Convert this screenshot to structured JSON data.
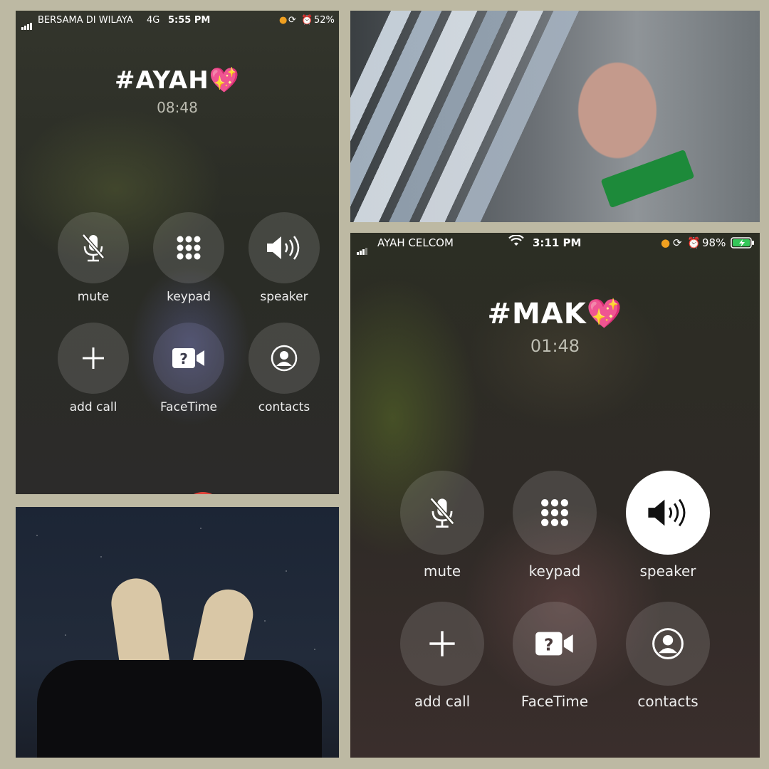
{
  "left_call": {
    "status": {
      "carrier": "BERSAMA DI WILAYA",
      "network": "4G",
      "time": "5:55 PM",
      "battery": "52%"
    },
    "contact": "#AYAH💖",
    "timer": "08:48",
    "buttons": [
      {
        "label": "mute",
        "icon": "mic-slash-icon"
      },
      {
        "label": "keypad",
        "icon": "keypad-icon"
      },
      {
        "label": "speaker",
        "icon": "speaker-icon"
      },
      {
        "label": "add call",
        "icon": "plus-icon"
      },
      {
        "label": "FaceTime",
        "icon": "facetime-icon"
      },
      {
        "label": "contacts",
        "icon": "contacts-icon"
      }
    ]
  },
  "right_call": {
    "status": {
      "carrier": "AYAH CELCOM",
      "time": "3:11 PM",
      "battery": "98%"
    },
    "contact": "#MAK💖",
    "timer": "01:48",
    "buttons": [
      {
        "label": "mute",
        "icon": "mic-slash-icon"
      },
      {
        "label": "keypad",
        "icon": "keypad-icon"
      },
      {
        "label": "speaker",
        "icon": "speaker-icon",
        "active": true
      },
      {
        "label": "add call",
        "icon": "plus-icon"
      },
      {
        "label": "FaceTime",
        "icon": "facetime-icon"
      },
      {
        "label": "contacts",
        "icon": "contacts-icon"
      }
    ]
  },
  "colors": {
    "frame": "#bdb9a3",
    "end_call": "#e0443a",
    "battery_green": "#34c759"
  }
}
